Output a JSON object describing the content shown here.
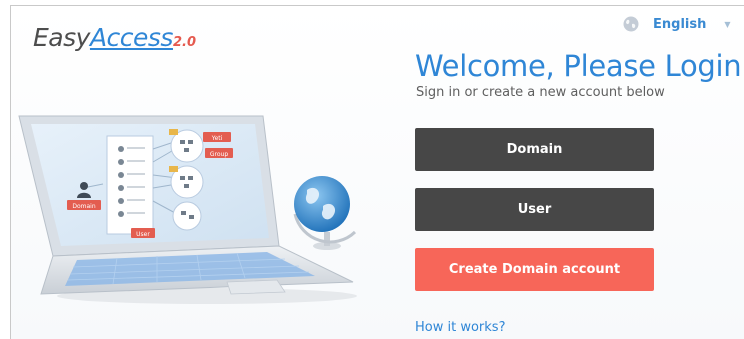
{
  "brand": {
    "logo_easy": "Easy",
    "logo_access": "Access",
    "logo_version": "2.0"
  },
  "language": {
    "selected": "English",
    "icon": "globe-icon",
    "dropdown_icon": "caret-down-icon"
  },
  "login": {
    "title": "Welcome, Please Login",
    "subtitle": "Sign in or create a new account below",
    "domain_button": "Domain",
    "user_button": "User",
    "create_button": "Create Domain account",
    "how_link": "How it works?"
  },
  "illustration": {
    "domain_label": "Domain",
    "user_label": "User",
    "tag_label_1": "Yeti",
    "tag_label_2": "Group"
  },
  "colors": {
    "accent": "#2f86d6",
    "dark_button": "#474747",
    "create_button": "#f76659"
  }
}
